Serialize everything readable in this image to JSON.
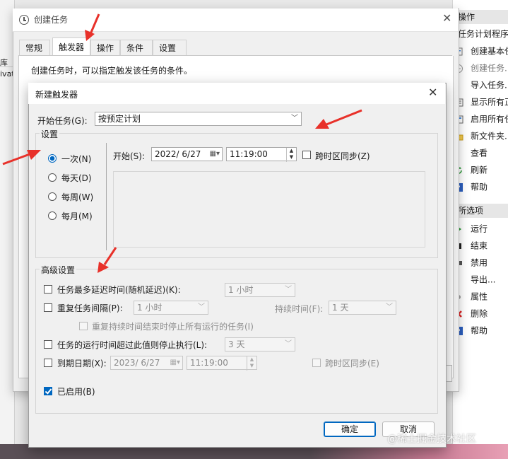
{
  "background_left": {
    "items": [
      "库",
      "ivat"
    ]
  },
  "actions_panel": {
    "header": "操作",
    "section1_title": "任务计划程序库",
    "section1_items": [
      {
        "label": "创建基本任务",
        "icon": "task-icon"
      },
      {
        "label": "创建任务...",
        "icon": "task-icon"
      },
      {
        "label": "导入任务...",
        "icon": "import-icon"
      },
      {
        "label": "显示所有正在运行的任务",
        "icon": "list-icon"
      },
      {
        "label": "启用所有任务历史记录",
        "icon": "history-icon"
      },
      {
        "label": "新文件夹...",
        "icon": "folder-icon"
      },
      {
        "label": "查看",
        "icon": "view-icon"
      },
      {
        "label": "刷新",
        "icon": "refresh-icon"
      },
      {
        "label": "帮助",
        "icon": "help-icon"
      }
    ],
    "section2_title": "所选项",
    "section2_items": [
      {
        "label": "运行",
        "icon": "run-icon"
      },
      {
        "label": "结束",
        "icon": "stop-icon"
      },
      {
        "label": "禁用",
        "icon": "disable-icon"
      },
      {
        "label": "导出...",
        "icon": "export-icon"
      },
      {
        "label": "属性",
        "icon": "properties-icon"
      },
      {
        "label": "删除",
        "icon": "delete-icon"
      },
      {
        "label": "帮助",
        "icon": "help-icon"
      }
    ]
  },
  "create_task": {
    "title": "创建任务",
    "tabs": [
      "常规",
      "触发器",
      "操作",
      "条件",
      "设置"
    ],
    "active_tab": "触发器",
    "description": "创建任务时，可以指定触发该任务的条件。"
  },
  "new_trigger": {
    "title": "新建触发器",
    "begin_task_label": "开始任务(G):",
    "begin_task_value": "按预定计划",
    "settings_title": "设置",
    "schedule_options": [
      "一次(N)",
      "每天(D)",
      "每周(W)",
      "每月(M)"
    ],
    "selected_schedule": "一次(N)",
    "start_label": "开始(S):",
    "start_date": "2022/ 6/27",
    "start_time": "11:19:00",
    "sync_tz_label": "跨时区同步(Z)",
    "advanced_title": "高级设置",
    "delay_label": "任务最多延迟时间(随机延迟)(K):",
    "delay_value": "1 小时",
    "repeat_label": "重复任务间隔(P):",
    "repeat_value": "1 小时",
    "duration_label": "持续时间(F):",
    "duration_value": "1 天",
    "stop_all_label": "重复持续时间结束时停止所有运行的任务(I)",
    "stop_if_longer_label": "任务的运行时间超过此值则停止执行(L):",
    "stop_if_longer_value": "3 天",
    "expire_label": "到期日期(X):",
    "expire_date": "2023/ 6/27",
    "expire_time": "11:19:00",
    "expire_sync_label": "跨时区同步(E)",
    "enabled_label": "已启用(B)",
    "ok_label": "确定",
    "cancel_label": "取消"
  },
  "watermark": "@稀土掘金技术社区",
  "colors": {
    "accent": "#0067c0",
    "annotation_arrow": "#e8312a"
  }
}
